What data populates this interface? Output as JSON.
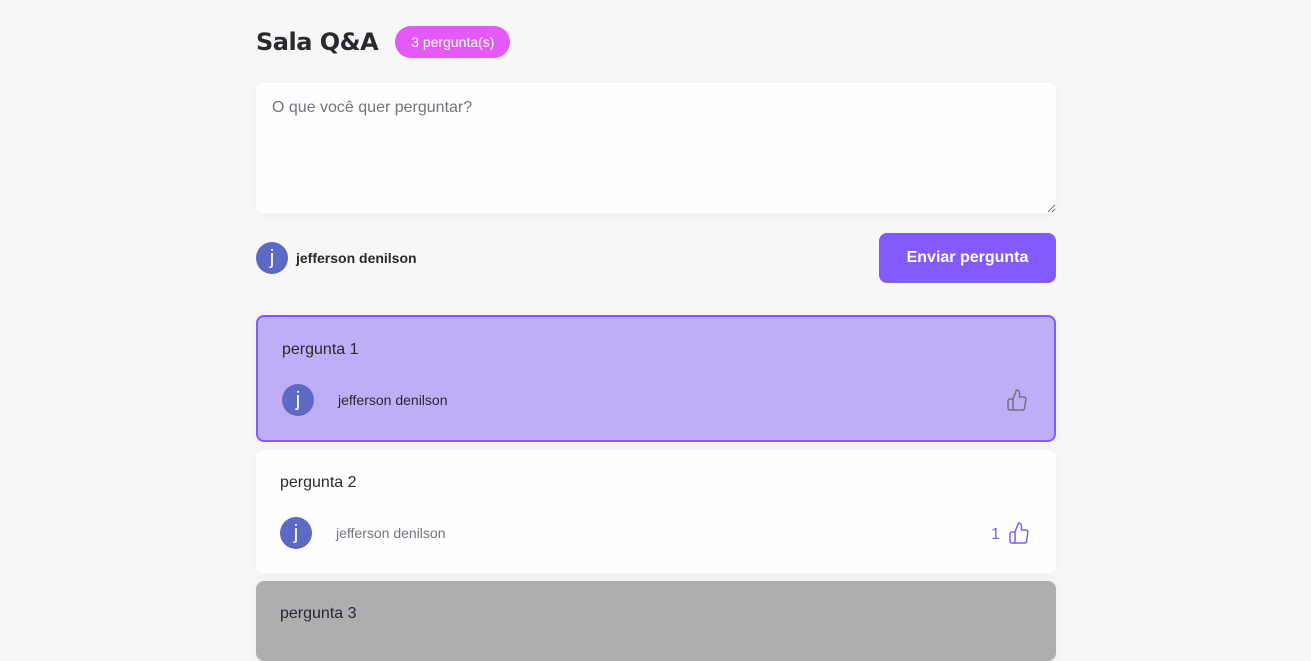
{
  "header": {
    "room_title": "Sala Q&A",
    "question_count_badge": "3 pergunta(s)"
  },
  "form": {
    "placeholder": "O que você quer perguntar?",
    "user": {
      "avatar_initial": "j",
      "name": "jefferson denilson"
    },
    "send_label": "Enviar pergunta"
  },
  "questions": [
    {
      "content": "pergunta 1",
      "author": {
        "avatar_initial": "j",
        "name": "jefferson denilson"
      },
      "like_count": "",
      "state": "highlighted",
      "like_icon": "thumbs-up-icon"
    },
    {
      "content": "pergunta 2",
      "author": {
        "avatar_initial": "j",
        "name": "jefferson denilson"
      },
      "like_count": "1",
      "state": "normal",
      "like_icon": "thumbs-up-icon"
    },
    {
      "content": "pergunta 3",
      "state": "answered"
    }
  ],
  "colors": {
    "accent": "#835afd",
    "badge": "#e559f9",
    "avatar": "#5d6ac3",
    "highlight_bg": "#bdaef7",
    "answered_bg": "#aeaeb0",
    "like_icon_default": "#737380"
  }
}
